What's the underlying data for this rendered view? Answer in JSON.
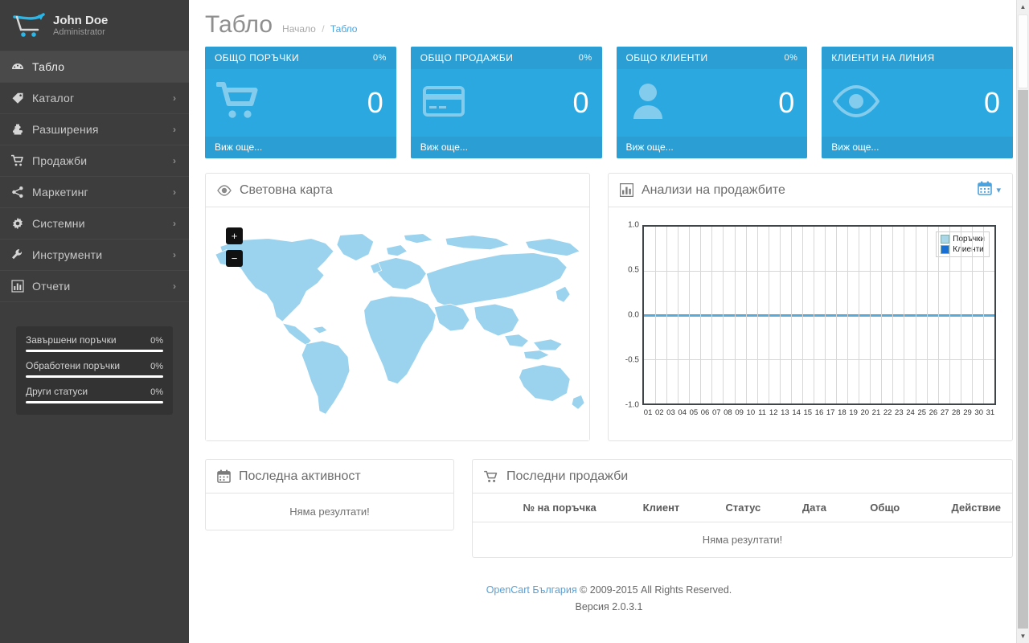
{
  "sidebar": {
    "user": {
      "name": "John Doe",
      "role": "Administrator"
    },
    "items": [
      {
        "label": "Табло",
        "icon": "dashboard-icon",
        "active": true,
        "caret": ""
      },
      {
        "label": "Каталог",
        "icon": "tag-icon",
        "active": false,
        "caret": "›"
      },
      {
        "label": "Разширения",
        "icon": "puzzle-icon",
        "active": false,
        "caret": "›"
      },
      {
        "label": "Продажби",
        "icon": "cart-icon",
        "active": false,
        "caret": "›"
      },
      {
        "label": "Маркетинг",
        "icon": "share-icon",
        "active": false,
        "caret": "›"
      },
      {
        "label": "Системни",
        "icon": "gear-icon",
        "active": false,
        "caret": "›"
      },
      {
        "label": "Инструменти",
        "icon": "wrench-icon",
        "active": false,
        "caret": "›"
      },
      {
        "label": "Отчети",
        "icon": "bar-chart-icon",
        "active": false,
        "caret": "›"
      }
    ],
    "stats": [
      {
        "label": "Завършени поръчки",
        "percent": "0%",
        "value": 0
      },
      {
        "label": "Обработени поръчки",
        "percent": "0%",
        "value": 0
      },
      {
        "label": "Други статуси",
        "percent": "0%",
        "value": 0
      }
    ]
  },
  "header": {
    "title": "Табло",
    "breadcrumb": {
      "home": "Начало",
      "separator": "/",
      "current": "Табло"
    }
  },
  "tiles": [
    {
      "title": "ОБЩО ПОРЪЧКИ",
      "percent": "0%",
      "value": "0",
      "footer": "Виж още...",
      "icon": "shopping-cart-icon"
    },
    {
      "title": "ОБЩО ПРОДАЖБИ",
      "percent": "0%",
      "value": "0",
      "footer": "Виж още...",
      "icon": "credit-card-icon"
    },
    {
      "title": "ОБЩО КЛИЕНТИ",
      "percent": "0%",
      "value": "0",
      "footer": "Виж още...",
      "icon": "user-icon"
    },
    {
      "title": "КЛИЕНТИ НА ЛИНИЯ",
      "percent": "",
      "value": "0",
      "footer": "Виж още...",
      "icon": "eye-icon"
    }
  ],
  "map_panel": {
    "title": "Световна карта",
    "icon": "eye-icon",
    "zoom_in": "+",
    "zoom_out": "−"
  },
  "chart_panel": {
    "title": "Анализи на продажбите",
    "icon": "bar-chart-icon",
    "calendar_icon": "calendar-icon",
    "caret": "▾"
  },
  "activity_panel": {
    "title": "Последна активност",
    "icon": "calendar-icon",
    "empty": "Няма резултати!"
  },
  "sales_panel": {
    "title": "Последни продажби",
    "icon": "cart-icon",
    "columns": [
      "№ на поръчка",
      "Клиент",
      "Статус",
      "Дата",
      "Общо",
      "Действие"
    ],
    "rows": [],
    "empty": "Няма резултати!"
  },
  "footer": {
    "link": "OpenCart България",
    "copyright": "© 2009-2015 All Rights Reserved.",
    "version": "Версия 2.0.3.1"
  },
  "colors": {
    "tile_blue": "#2ba8e0",
    "tile_blue_dark": "#2b9fd4",
    "sidebar": "#3d3d3d",
    "accent_link": "#4aa3df",
    "map_land": "#9bd3ee",
    "series_orders": "#a9d6e8",
    "series_customers": "#1a6fd4"
  },
  "chart_data": {
    "type": "line",
    "title": "Анализи на продажбите",
    "xlabel": "",
    "ylabel": "",
    "x": [
      "01",
      "02",
      "03",
      "04",
      "05",
      "06",
      "07",
      "08",
      "09",
      "10",
      "11",
      "12",
      "13",
      "14",
      "15",
      "16",
      "17",
      "18",
      "19",
      "20",
      "21",
      "22",
      "23",
      "24",
      "25",
      "26",
      "27",
      "28",
      "29",
      "30",
      "31"
    ],
    "series": [
      {
        "name": "Поръчки",
        "color": "#a9d6e8",
        "values": [
          0,
          0,
          0,
          0,
          0,
          0,
          0,
          0,
          0,
          0,
          0,
          0,
          0,
          0,
          0,
          0,
          0,
          0,
          0,
          0,
          0,
          0,
          0,
          0,
          0,
          0,
          0,
          0,
          0,
          0,
          0
        ]
      },
      {
        "name": "Клиенти",
        "color": "#1a6fd4",
        "values": [
          0,
          0,
          0,
          0,
          0,
          0,
          0,
          0,
          0,
          0,
          0,
          0,
          0,
          0,
          0,
          0,
          0,
          0,
          0,
          0,
          0,
          0,
          0,
          0,
          0,
          0,
          0,
          0,
          0,
          0,
          0
        ]
      }
    ],
    "ylim": [
      -1.0,
      1.0
    ],
    "yticks": [
      "1.0",
      "0.5",
      "0.0",
      "-0.5",
      "-1.0"
    ],
    "grid": true,
    "legend_position": "top-right"
  },
  "scrollbar": {
    "up": "▲",
    "down": "▼"
  }
}
